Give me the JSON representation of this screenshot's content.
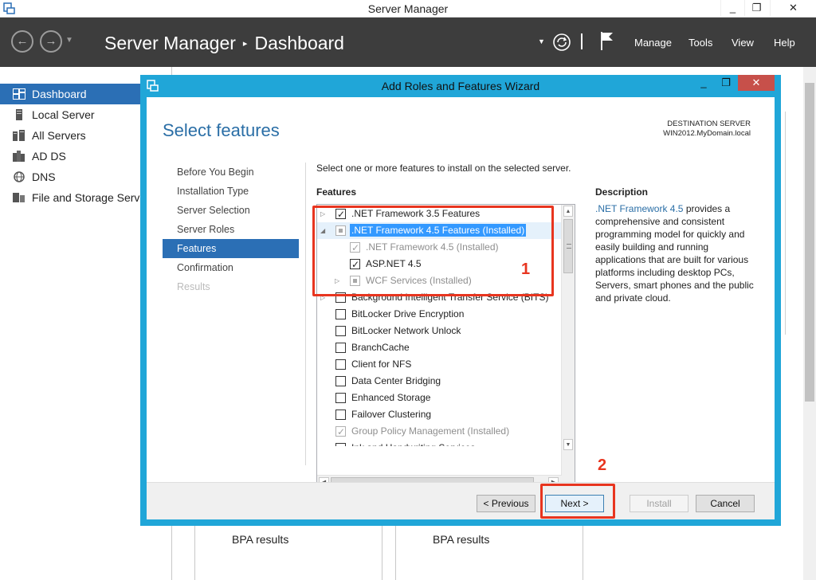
{
  "window": {
    "title": "Server Manager",
    "controls": [
      "_",
      "❐",
      "✕"
    ]
  },
  "header": {
    "back_icon": "back-arrow-icon",
    "forward_icon": "forward-arrow-icon",
    "title": "Server Manager",
    "separator": "▸",
    "page": "Dashboard",
    "menus": [
      "Manage",
      "Tools",
      "View",
      "Help"
    ]
  },
  "sidebar": {
    "items": [
      {
        "label": "Dashboard",
        "icon": "dashboard-icon",
        "active": true
      },
      {
        "label": "Local Server",
        "icon": "local-server-icon"
      },
      {
        "label": "All Servers",
        "icon": "all-servers-icon"
      },
      {
        "label": "AD DS",
        "icon": "ad-ds-icon"
      },
      {
        "label": "DNS",
        "icon": "dns-icon"
      },
      {
        "label": "File and Storage Services",
        "icon": "file-storage-icon"
      }
    ]
  },
  "background": {
    "bpa_cards": [
      "BPA results",
      "BPA results"
    ]
  },
  "wizard": {
    "title": "Add Roles and Features Wizard",
    "controls": [
      "_",
      "❐",
      "✕"
    ],
    "page_title": "Select features",
    "destination_label": "DESTINATION SERVER",
    "destination_server": "WIN2012.MyDomain.local",
    "steps": [
      {
        "label": "Before You Begin"
      },
      {
        "label": "Installation Type"
      },
      {
        "label": "Server Selection"
      },
      {
        "label": "Server Roles"
      },
      {
        "label": "Features",
        "active": true
      },
      {
        "label": "Confirmation"
      },
      {
        "label": "Results",
        "disabled": true
      }
    ],
    "instruction": "Select one or more features to install on the selected server.",
    "features_label": "Features",
    "features": [
      {
        "label": ".NET Framework 3.5 Features",
        "checked": true,
        "expander": "▷"
      },
      {
        "label": ".NET Framework 4.5 Features (Installed)",
        "partial": true,
        "expander": "◢",
        "selected": true
      },
      {
        "label": ".NET Framework 4.5 (Installed)",
        "checked": true,
        "installed": true
      },
      {
        "label": "ASP.NET 4.5",
        "checked": true
      },
      {
        "label": "WCF Services (Installed)",
        "installed": true,
        "partial": true,
        "expander": "▷"
      },
      {
        "label": "Background Intelligent Transfer Service (BITS)",
        "expander": "▷"
      },
      {
        "label": "BitLocker Drive Encryption"
      },
      {
        "label": "BitLocker Network Unlock"
      },
      {
        "label": "BranchCache"
      },
      {
        "label": "Client for NFS"
      },
      {
        "label": "Data Center Bridging"
      },
      {
        "label": "Enhanced Storage"
      },
      {
        "label": "Failover Clustering"
      },
      {
        "label": "Group Policy Management (Installed)",
        "checked": true,
        "installed": true
      },
      {
        "label": "Ink and Handwriting Services"
      }
    ],
    "description_label": "Description",
    "description_link": ".NET Framework 4.5",
    "description_text": " provides a comprehensive and consistent programming model for quickly and easily building and running applications that are built for various platforms including desktop PCs, Servers, smart phones and the public and private cloud.",
    "buttons": {
      "previous": "< Previous",
      "next": "Next >",
      "install": "Install",
      "cancel": "Cancel"
    }
  },
  "annotations": {
    "first": "1",
    "second": "2",
    "color": "#e8351f"
  },
  "colors": {
    "accent": "#2b6fb5",
    "wizard_border": "#20a6d8",
    "header_bg": "#3d3d3d"
  }
}
